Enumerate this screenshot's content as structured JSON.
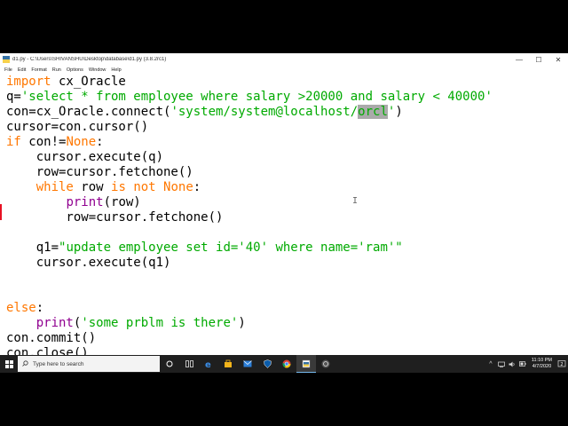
{
  "window": {
    "title": "d1.py - C:\\Users\\SHIVANSHU\\Desktop\\database\\d1.py (3.8.2rc1)",
    "minimize": "—",
    "maximize": "☐",
    "close": "✕"
  },
  "menu": [
    "File",
    "Edit",
    "Format",
    "Run",
    "Options",
    "Window",
    "Help"
  ],
  "code": {
    "l1_kw": "import",
    "l1_rest": " cx_Oracle",
    "l2_pre": "q=",
    "l2_str": "'select * from employee where salary >20000 and salary < 40000'",
    "l3_pre": "con=cx_Oracle.connect(",
    "l3_str_a": "'system/system@localhost/",
    "l3_sel": "orcl",
    "l3_str_b": "'",
    "l3_post": ")",
    "l4": "cursor=con.cursor()",
    "l5_kw": "if",
    "l5_mid": " con!=",
    "l5_kw2": "None",
    "l5_end": ":",
    "l6": "    cursor.execute(q)",
    "l7": "    row=cursor.fetchone()",
    "l8_indent": "    ",
    "l8_kw1": "while",
    "l8_mid": " row ",
    "l8_kw2": "is not None",
    "l8_end": ":",
    "l9_indent": "        ",
    "l9_bi": "print",
    "l9_rest": "(row)",
    "l10": "        row=cursor.fetchone()",
    "l11_pre": "    q1=",
    "l11_str": "\"update employee set id='40' where name='ram'\"",
    "l12": "    cursor.execute(q1)",
    "l13_kw": "else",
    "l13_end": ":",
    "l14_indent": "    ",
    "l14_bi": "print",
    "l14_open": "(",
    "l14_str": "'some prblm is there'",
    "l14_close": ")",
    "l15": "con.commit()",
    "l16": "con.close()"
  },
  "taskbar": {
    "search_placeholder": "Type here to search",
    "time": "11:10 PM",
    "date": "4/7/2020",
    "tray_chevron": "^",
    "notifications": "2"
  },
  "colors": {
    "keyword": "#ff7700",
    "string": "#00aa00",
    "builtin": "#900090",
    "selection": "#aaaaaa"
  }
}
